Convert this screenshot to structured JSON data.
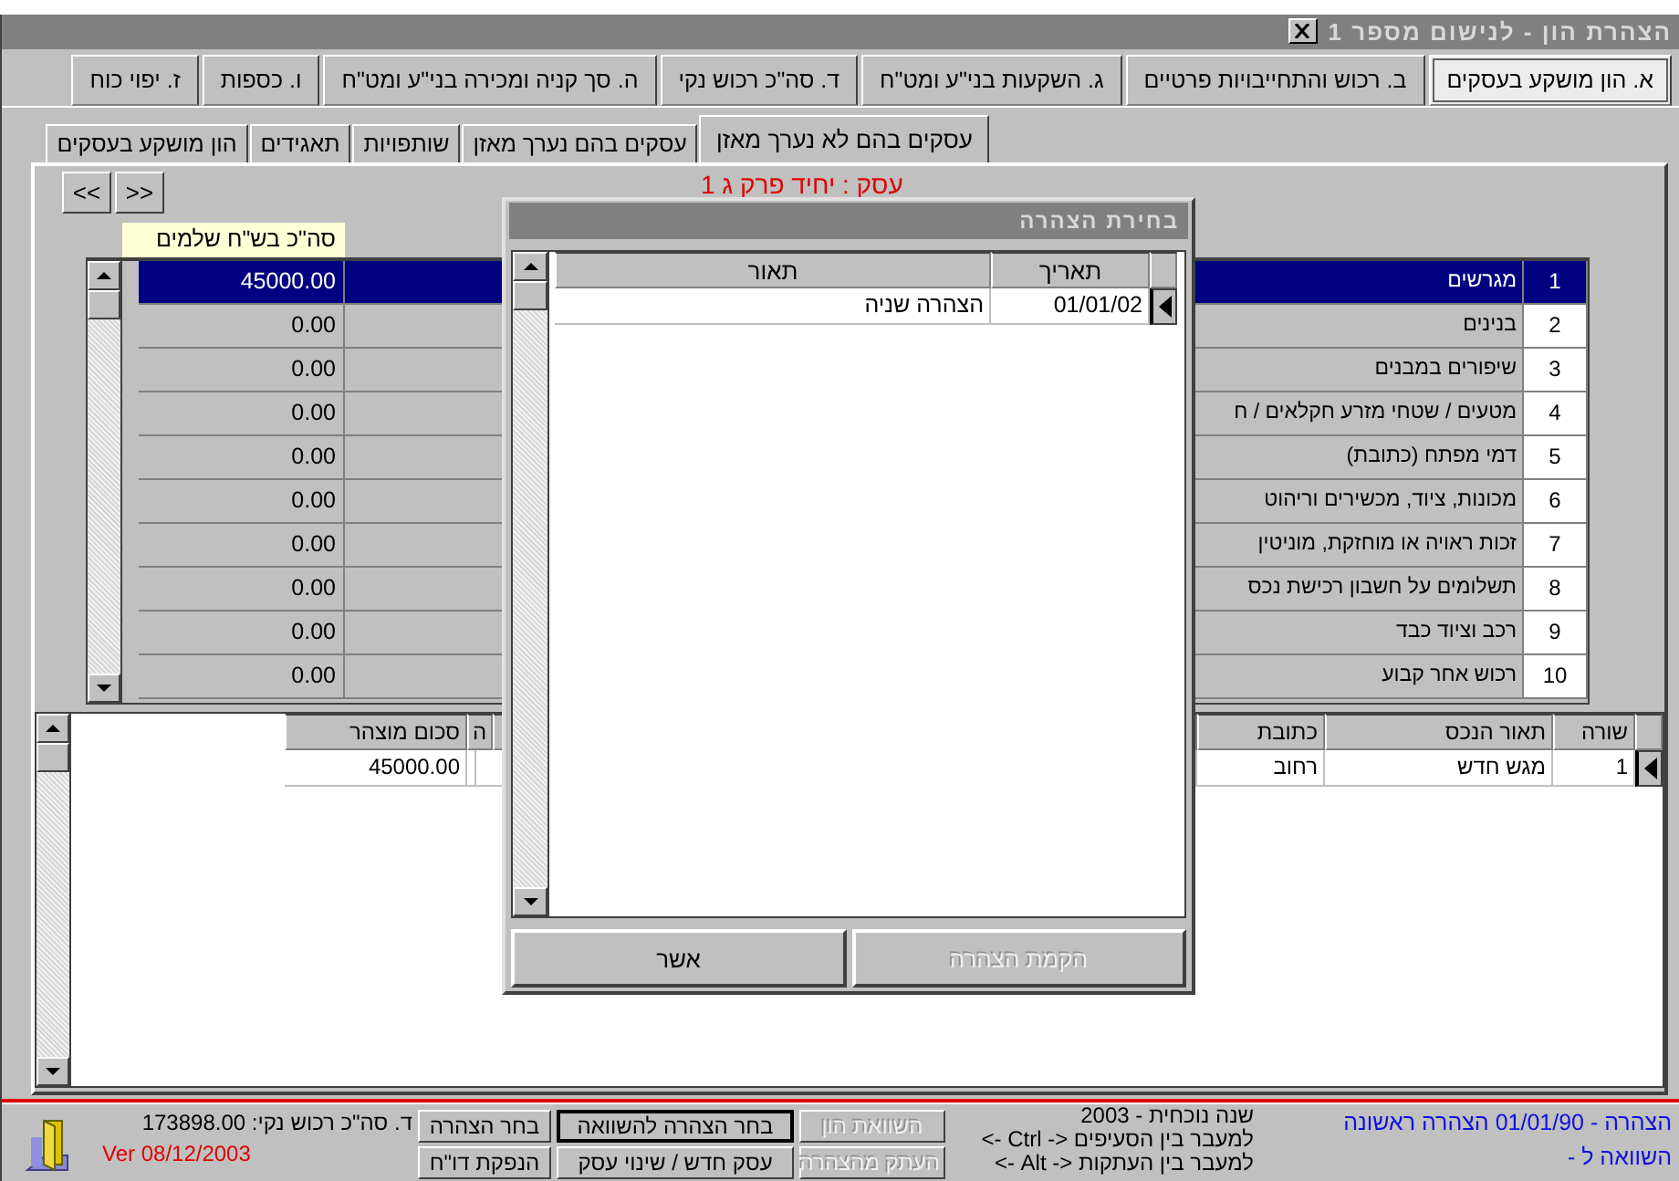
{
  "window": {
    "title": "הצהרת הון - לנישום מספר 1"
  },
  "main_tabs": [
    {
      "label": "א. הון מושקע בעסקים",
      "selected": true
    },
    {
      "label": "ב. רכוש והתחייבויות פרטיים",
      "selected": false
    },
    {
      "label": "ג. השקעות בני\"ע ומט\"ח",
      "selected": false
    },
    {
      "label": "ד. סה\"כ רכוש נקי",
      "selected": false
    },
    {
      "label": "ה. סך קניה ומכירה בני\"ע ומט\"ח",
      "selected": false
    },
    {
      "label": "ו. כספות",
      "selected": false
    },
    {
      "label": "ז. יפוי כוח",
      "selected": false
    }
  ],
  "sub_tabs": [
    {
      "label": "עסקים בהם לא נערך מאזן",
      "selected": true
    },
    {
      "label": "עסקים בהם נערך מאזן",
      "selected": false
    },
    {
      "label": "שותפויות",
      "selected": false
    },
    {
      "label": "תאגידים",
      "selected": false
    },
    {
      "label": "הון מושקע בעסקים",
      "selected": false
    }
  ],
  "business_label": "עסק : יחיד פרק ג 1",
  "nav_buttons": [
    ">>",
    "<<"
  ],
  "tooltip": "סה\"כ בש\"ח שלמים",
  "assets": [
    {
      "number": "1",
      "name": "מגרשים",
      "amount": "45000.00",
      "selected": true
    },
    {
      "number": "2",
      "name": "בנינים",
      "amount": "0.00",
      "selected": false
    },
    {
      "number": "3",
      "name": "שיפורים במבנים",
      "amount": "0.00",
      "selected": false
    },
    {
      "number": "4",
      "name": "מטעים / שטחי מזרע חקלאים / ח",
      "amount": "0.00",
      "selected": false
    },
    {
      "number": "5",
      "name": "דמי מפתח (כתובת)",
      "amount": "0.00",
      "selected": false
    },
    {
      "number": "6",
      "name": "מכונות, ציוד, מכשירים וריהוט",
      "amount": "0.00",
      "selected": false
    },
    {
      "number": "7",
      "name": "זכות ראויה או מוחזקת, מוניטין",
      "amount": "0.00",
      "selected": false
    },
    {
      "number": "8",
      "name": "תשלומים על חשבון רכישת נכס",
      "amount": "0.00",
      "selected": false
    },
    {
      "number": "9",
      "name": "רכב וציוד כבד",
      "amount": "0.00",
      "selected": false
    },
    {
      "number": "10",
      "name": "רכוש אחר קבוע",
      "amount": "0.00",
      "selected": false
    }
  ],
  "declared_assets": {
    "columns": [
      "שורה",
      "תאור הנכס",
      "כתובת",
      "ה",
      "סכום מוצהר"
    ],
    "rows": [
      {
        "line": "1",
        "description": "מגש חדש",
        "address": "רחוב",
        "amount": "45000.00",
        "current": true
      }
    ]
  },
  "dialog": {
    "title": "בחירת הצהרה",
    "columns": [
      "תאריך",
      "תאור"
    ],
    "rows": [
      {
        "date": "01/01/02",
        "description": "הצהרה שניה",
        "current": true
      }
    ],
    "buttons": [
      {
        "label": "הקמת הצהרה",
        "disabled": true
      },
      {
        "label": "אשר",
        "disabled": false
      }
    ]
  },
  "status_bar": {
    "net_worth": "ד. סה\"כ רכוש נקי: 173898.00",
    "version": "Ver 08/12/2003",
    "buttons": [
      {
        "label": "השוואת הון",
        "disabled": true,
        "default": false
      },
      {
        "label": "בחר הצהרה להשוואה",
        "disabled": false,
        "default": true
      },
      {
        "label": "בחר הצהרה",
        "disabled": false,
        "default": false
      },
      {
        "label": "העתק מהצהרה",
        "disabled": true,
        "default": false
      },
      {
        "label": "עסק חדש / שינוי עסק",
        "disabled": false,
        "default": false
      },
      {
        "label": "הנפקת דו\"ח",
        "disabled": false,
        "default": false
      }
    ],
    "hints": [
      "שנה נוכחית - 2003",
      "למעבר בין הסעיפים <- Ctrl ->",
      "למעבר בין העתקות <- Alt ->"
    ],
    "current_declaration": "הצהרה - 01/01/90 הצהרה ראשונה",
    "compare_to": "השוואה ל -"
  }
}
